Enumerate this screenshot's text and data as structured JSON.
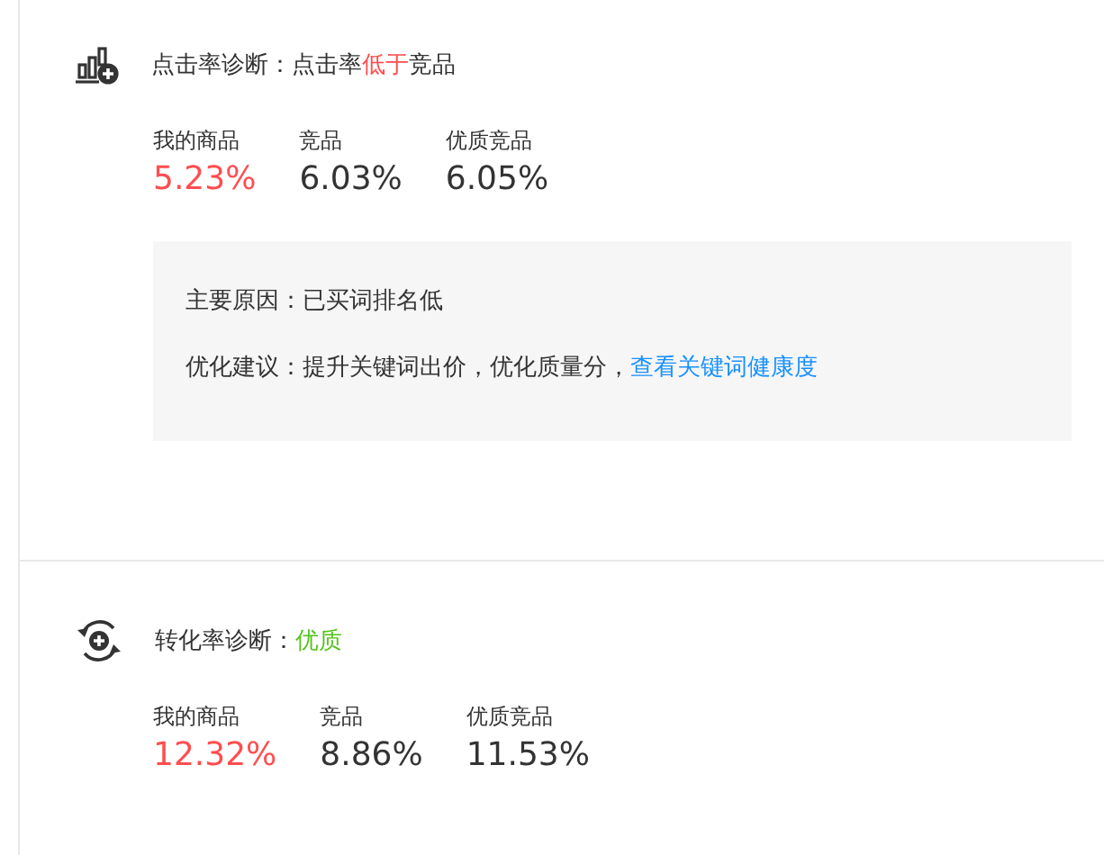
{
  "sections": [
    {
      "kind": "click_rate",
      "title": "点击率诊断：",
      "verdict": [
        {
          "text": "点击率",
          "color": "#333333"
        },
        {
          "text": "低于",
          "color": "#ff4d4f"
        },
        {
          "text": "竞品",
          "color": "#333333"
        }
      ],
      "metrics": [
        {
          "label": "我的商品",
          "value": "5.23%",
          "kind": "own"
        },
        {
          "label": "竞品",
          "value": "6.03%",
          "kind": "peer"
        },
        {
          "label": "优质竞品",
          "value": "6.05%",
          "kind": "peer"
        }
      ],
      "advice": {
        "reason_label": "主要原因：",
        "reason": "已买词排名低",
        "suggest_label": "优化建议：",
        "suggest": "提升关键词出价，优化质量分，",
        "link": "查看关键词健康度"
      }
    },
    {
      "kind": "conversion_rate",
      "title": "转化率诊断：",
      "verdict": [
        {
          "text": "优质",
          "color": "#52c41a"
        }
      ],
      "metrics": [
        {
          "label": "我的商品",
          "value": "12.32%",
          "kind": "own"
        },
        {
          "label": "竞品",
          "value": "8.86%",
          "kind": "peer"
        },
        {
          "label": "优质竞品",
          "value": "11.53%",
          "kind": "peer"
        }
      ]
    }
  ]
}
